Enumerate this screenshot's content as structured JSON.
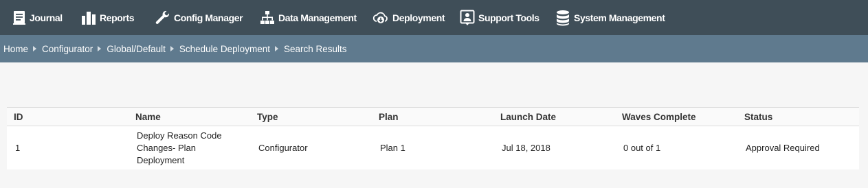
{
  "nav": {
    "items": [
      {
        "label": "Journal",
        "icon": "journal-icon"
      },
      {
        "label": "Reports",
        "icon": "bar-chart-icon"
      },
      {
        "label": "Config Manager",
        "icon": "wrench-icon"
      },
      {
        "label": "Data Management",
        "icon": "sitemap-icon"
      },
      {
        "label": "Deployment",
        "icon": "cloud-download-icon"
      },
      {
        "label": "Support Tools",
        "icon": "support-person-icon"
      },
      {
        "label": "System Management",
        "icon": "database-icon"
      }
    ]
  },
  "breadcrumb": {
    "items": [
      "Home",
      "Configurator",
      "Global/Default",
      "Schedule Deployment",
      "Search Results"
    ]
  },
  "table": {
    "columns": [
      "ID",
      "Name",
      "Type",
      "Plan",
      "Launch Date",
      "Waves Complete",
      "Status"
    ],
    "rows": [
      {
        "id": "1",
        "name": "Deploy Reason Code Changes- Plan Deployment",
        "type": "Configurator",
        "plan": "Plan 1",
        "launch_date": "Jul 18, 2018",
        "waves_complete": "0 out of 1",
        "status": "Approval Required"
      }
    ]
  },
  "colors": {
    "nav_bg": "#3f4e58",
    "breadcrumb_bg": "#5f7a8e",
    "page_bg": "#f6f6f6"
  }
}
